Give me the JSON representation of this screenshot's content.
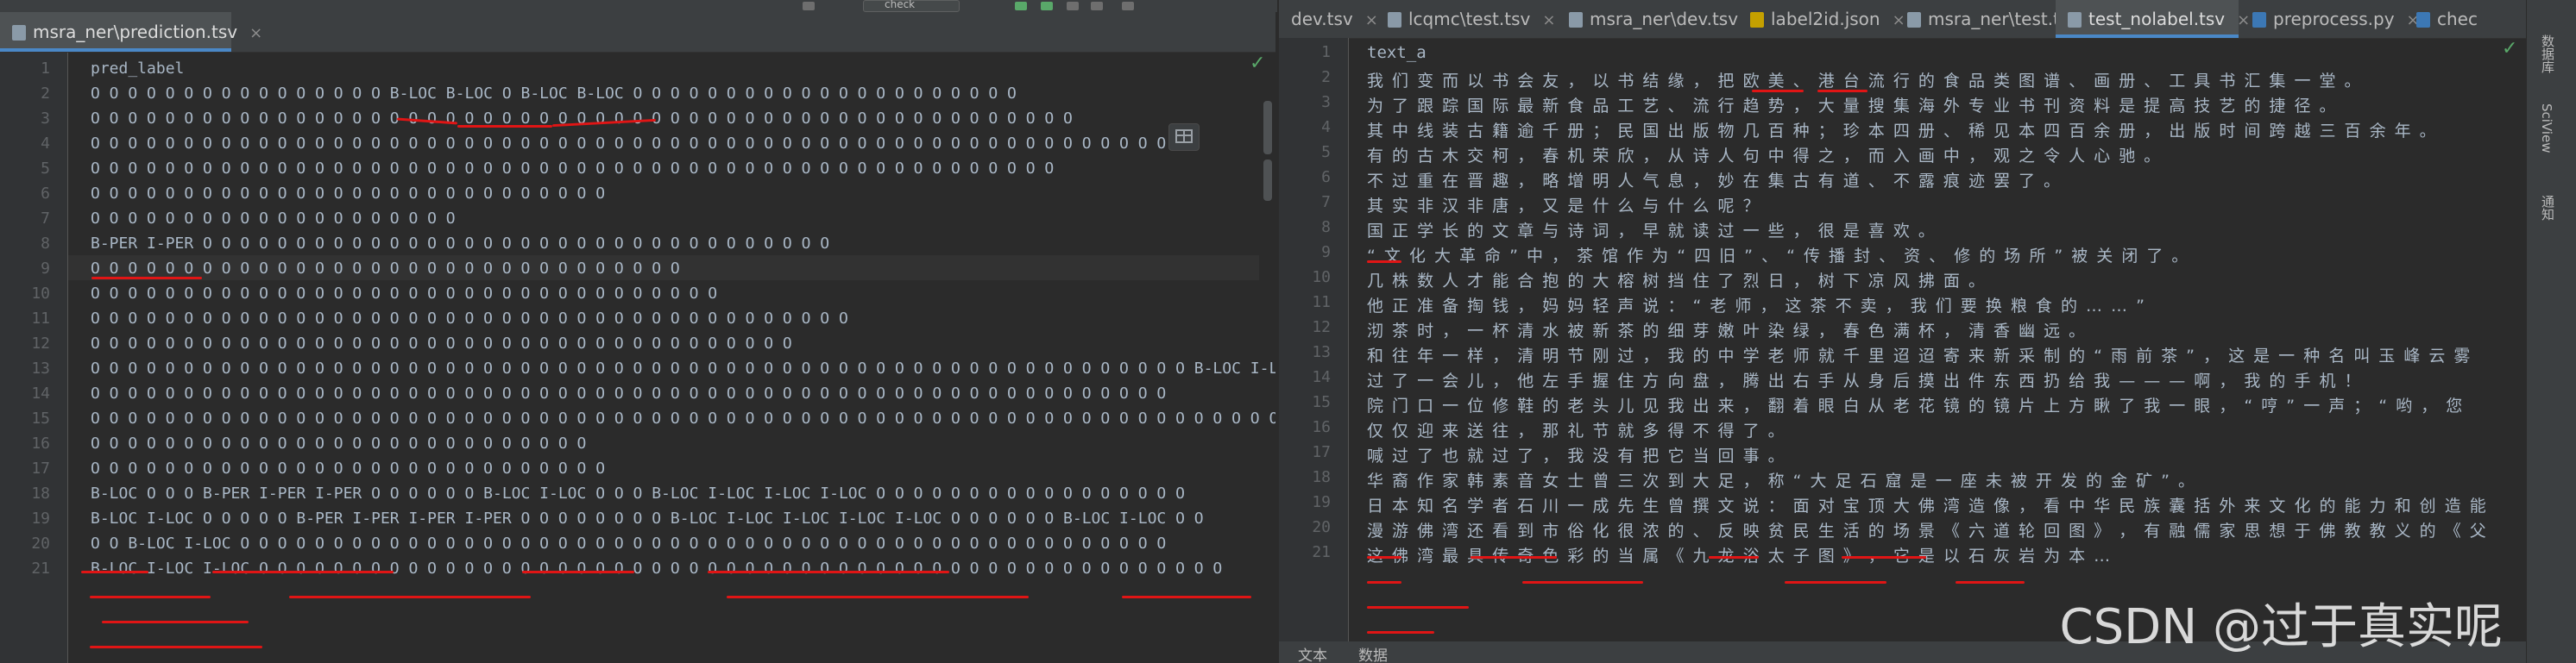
{
  "left": {
    "tab_label": "msra_ner\\prediction.tsv",
    "tab_close": "×",
    "lines": [
      "pred_label",
      "O O O O O O O O O O O O O O O O B-LOC B-LOC O B-LOC B-LOC O O O O O O O O O O O O O O O O O O O O O",
      "O O O O O O O O O O O O O O O O O O O O O O O O O O O O O O O O O O O O O O O O O O O O O O O O O O O O O",
      "O O O O O O O O O O O O O O O O O O O O O O O O O O O O O O O O O O O O O O O O O O O O O O O O O O O O O O O O O O",
      "O O O O O O O O O O O O O O O O O O O O O O O O O O O O O O O O O O O O O O O O O O O O O O O O O O O O",
      "O O O O O O O O O O O O O O O O O O O O O O O O O O O O",
      "O O O O O O O O O O O O O O O O O O O O",
      "B-PER I-PER O O O O O O O O O O O O O O O O O O O O O O O O O O O O O O O O O O",
      "O O O O O O O O O O O O O O O O O O O O O O O O O O O O O O O O",
      "O O O O O O O O O O O O O O O O O O O O O O O O O O O O O O O O O O",
      "O O O O O O O O O O O O O O O O O O O O O O O O O O O O O O O O O O O O O O O O O",
      "O O O O O O O O O O O O O O O O O O O O O O O O O O O O O O O O O O O O O O",
      "O O O O O O O O O O O O O O O O O O O O O O O O O O O O O O O O O O O O O O O O O O O O O O O O O O O O O O O O O O O B-LOC I-LOC O O O O O O O O O O O O O O O O O B",
      "O O O O O O O O O O O O O O O O O O O O O O O O O O O O O O O O O O O O O O O O O O O O O O O O O O O O O O O O O O",
      "O O O O O O O O O O O O O O O O O O O O O O O O O O O O O O O O O O O O O O O O O O O O O O O O O O O O O O O O O O O O O O O O O O O O O O O O O O O O O",
      "O O O O O O O O O O O O O O O O O O O O O O O O O O O",
      "O O O O O O O O O O O O O O O O O O O O O O O O O O O O",
      "B-LOC O O O B-PER I-PER I-PER O O O O O O B-LOC I-LOC O O O B-LOC I-LOC I-LOC I-LOC O O O O O O O O O O O O O O O O O",
      "B-LOC I-LOC O O O O O B-PER I-PER I-PER I-PER O O O O O O O O B-LOC I-LOC I-LOC I-LOC I-LOC O O O O O O B-LOC I-LOC O O",
      "O O B-LOC I-LOC O O O O O O O O O O O O O O O O O O O O O O O O O O O O O O O O O O O O O O O O O O O O O O O O O O",
      "B-LOC I-LOC I-LOC O O O O O O O O O O O O O O O O O O O O O O O O O O O O O O O O O O O O O O O O O O O O O O O O O O O O"
    ]
  },
  "right": {
    "tabs": [
      {
        "label": "dev.tsv"
      },
      {
        "label": "lcqmc\\test.tsv"
      },
      {
        "label": "msra_ner\\dev.tsv"
      },
      {
        "label": "label2id.json"
      },
      {
        "label": "msra_ner\\test.tsv"
      },
      {
        "label": "test_nolabel.tsv"
      },
      {
        "label": "preprocess.py"
      },
      {
        "label": "chec"
      }
    ],
    "tab_close": "×",
    "lines": [
      "text_a",
      "我 们 变 而 以 书 会 友 ， 以 书 结 缘 ， 把 欧 美 、 港 台 流 行 的 食 品 类 图 谱 、 画 册 、 工 具 书 汇 集 一 堂 。",
      "为 了 跟 踪 国 际 最 新 食 品 工 艺 、 流 行 趋 势 ， 大 量 搜 集 海 外 专 业 书 刊 资 料 是 提 高 技 艺 的 捷 径 。",
      "其 中 线 装 古 籍 逾 千 册 ； 民 国 出 版 物 几 百 种 ； 珍 本 四 册 、 稀 见 本 四 百 余 册 ， 出 版 时 间 跨 越 三 百 余 年 。",
      "有 的 古 木 交 柯 ， 春 机 荣 欣 ， 从 诗 人 句 中 得 之 ， 而 入 画 中 ， 观 之 令 人 心 驰 。",
      "不 过 重 在 晋 趣 ， 略 增 明 人 气 息 ， 妙 在 集 古 有 道 、 不 露 痕 迹 罢 了 。",
      "其 实 非 汉 非 唐 ， 又 是 什 么 与 什 么 呢 ？",
      "国 正 学 长 的 文 章 与 诗 词 ， 早 就 读 过 一 些 ， 很 是 喜 欢 。",
      "“ 文 化 大 革 命 ” 中 ， 茶 馆 作 为 “ 四 旧 ” 、 “ 传 播 封 、 资 、 修 的 场 所 ” 被 关 闭 了 。",
      "几 株 数 人 才 能 合 抱 的 大 榕 树 挡 住 了 烈 日 ， 树 下 凉 风 拂 面 。",
      "他 正 准 备 掏 钱 ， 妈 妈 轻 声 说 ： “ 老 师 ， 这 茶 不 卖 ， 我 们 要 换 粮 食 的 … … ”",
      "沏 茶 时 ， 一 杯 清 水 被 新 茶 的 细 芽 嫩 叶 染 绿 ， 春 色 满 杯 ， 清 香 幽 远 。",
      "和 往 年 一 样 ， 清 明 节 刚 过 ， 我 的 中 学 老 师 就 千 里 迢 迢 寄 来 新 采 制 的 “ 雨 前 茶 ” ， 这 是 一 种 名 叫 玉 峰 云 雾",
      "过 了 一 会 儿 ， 他 左 手 握 住 方 向 盘 ， 腾 出 右 手 从 身 后 摸 出 件 东 西 扔 给 我 — — — 啊 ， 我 的 手 机 ！",
      "院 门 口 一 位 修 鞋 的 老 头 儿 见 我 出 来 ， 翻 着 眼 白 从 老 花 镜 的 镜 片 上 方 瞅 了 我 一 眼 ， “ 哼 ” 一 声 ； “ 哟 ， 您",
      "仅 仅 迎 来 送 往 ， 那 礼 节 就 多 得 不 得 了 。",
      "喊 过 了 也 就 过 了 ， 我 没 有 把 它 当 回 事 。",
      "华 裔 作 家 韩 素 音 女 士 曾 三 次 到 大 足 ， 称 “ 大 足 石 窟 是 一 座 未 被 开 发 的 金 矿 ” 。",
      "日 本 知 名 学 者 石 川 一 成 先 生 曾 撰 文 说 ： 面 对 宝 顶 大 佛 湾 造 像 ， 看 中 华 民 族 囊 括 外 来 文 化 的 能 力 和 创 造 能",
      "漫 游 佛 湾 还 看 到 市 俗 化 很 浓 的 、 反 映 贫 民 生 活 的 场 景 《 六 道 轮 回 图 》 ， 有 融 儒 家 思 想 于 佛 教 教 义 的 《 父",
      "这 佛 湾 最 具 传 奇 色 彩 的 当 属 《 九 龙 浴 太 子 图 》 ， 它 是 以 石 灰 岩 为 本 …"
    ],
    "sidebar": [
      "数据库",
      "SciView",
      "通知"
    ],
    "bottom_tabs": [
      "文本",
      "数据"
    ]
  },
  "top": {
    "combo": "check"
  },
  "watermark": "CSDN @过于真实呢",
  "colors": {
    "accent": "#4a88c7",
    "underline": "#e01515",
    "check": "#59a869"
  }
}
